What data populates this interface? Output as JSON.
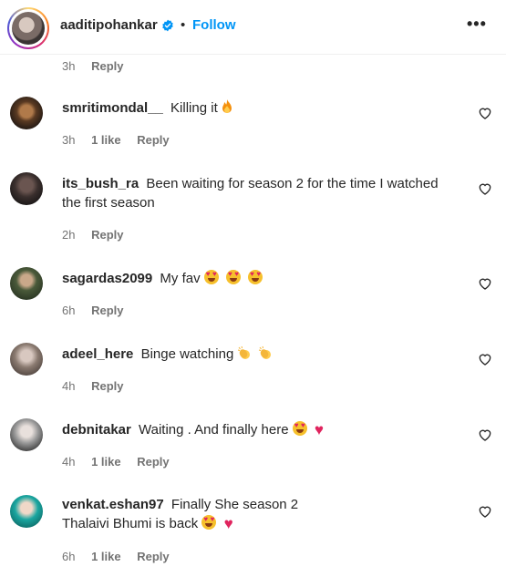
{
  "header": {
    "username": "aaditipohankar",
    "separator": "•",
    "follow_label": "Follow",
    "more_label": "•••"
  },
  "top_meta": {
    "time": "3h",
    "reply": "Reply"
  },
  "comments": [
    {
      "username": "smritimondal__",
      "text": "Killing it",
      "emojis": [
        "fire"
      ],
      "time": "3h",
      "likes": "1 like",
      "reply": "Reply",
      "avatar_color": "#6b4a2c"
    },
    {
      "username": "its_bush_ra",
      "text": "Been waiting for season 2 for the time I watched the first season",
      "emojis": [],
      "time": "2h",
      "likes": "",
      "reply": "Reply",
      "avatar_color": "#3a2f2d"
    },
    {
      "username": "sagardas2099",
      "text": "My fav",
      "emojis": [
        "smiling-face-heart-eyes",
        "smiling-face-heart-eyes",
        "smiling-face-heart-eyes"
      ],
      "time": "6h",
      "likes": "",
      "reply": "Reply",
      "avatar_color": "#4a5a3a"
    },
    {
      "username": "adeel_here",
      "text": "Binge watching",
      "emojis": [
        "clapping-hands",
        "clapping-hands"
      ],
      "time": "4h",
      "likes": "",
      "reply": "Reply",
      "avatar_color": "#8a7a70"
    },
    {
      "username": "debnitakar",
      "text": "Waiting . And finally here",
      "emojis": [
        "smiling-face-heart-eyes",
        "red-heart"
      ],
      "time": "4h",
      "likes": "1 like",
      "reply": "Reply",
      "avatar_color": "#9a9a9a"
    },
    {
      "username": "venkat.eshan97",
      "text": "Finally She season 2",
      "text2": "Thalaivi Bhumi is back",
      "emojis": [
        "smiling-face-heart-eyes",
        "red-heart"
      ],
      "time": "6h",
      "likes": "1 like",
      "reply": "Reply",
      "avatar_color": "#1aa6a0"
    }
  ],
  "colors": {
    "follow": "#0095f6",
    "meta": "#737373",
    "text": "#262626"
  }
}
